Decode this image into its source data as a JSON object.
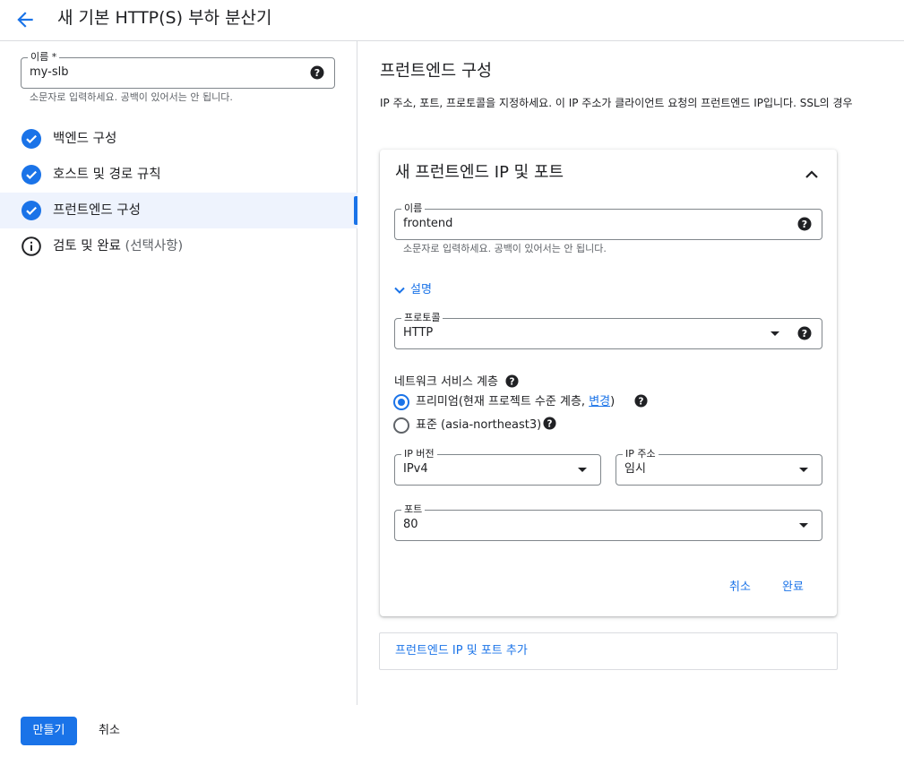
{
  "header": {
    "title": "새 기본 HTTP(S) 부하 분산기",
    "back_icon": "arrow-left-icon"
  },
  "name_field": {
    "label": "이름 *",
    "value": "my-slb",
    "hint": "소문자로 입력하세요. 공백이 있어서는 안 됩니다."
  },
  "steps": [
    {
      "label": "백엔드 구성",
      "icon": "check-circle-icon",
      "status": "complete"
    },
    {
      "label": "호스트 및 경로 규칙",
      "icon": "check-circle-icon",
      "status": "complete"
    },
    {
      "label": "프런트엔드 구성",
      "icon": "check-circle-icon",
      "status": "active"
    },
    {
      "label": "검토 및 완료",
      "optional": "(선택사항)",
      "icon": "info-icon",
      "status": "pending"
    }
  ],
  "main": {
    "title": "프런트엔드 구성",
    "description": "IP 주소, 포트, 프로토콜을 지정하세요. 이 IP 주소가 클라이언트 요청의 프런트엔드 IP입니다. SSL의 경우"
  },
  "card": {
    "title": "새 프런트엔드 IP 및 포트",
    "name": {
      "label": "이름",
      "value": "frontend",
      "hint": "소문자로 입력하세요. 공백이 있어서는 안 됩니다."
    },
    "description_toggle": "설명",
    "protocol": {
      "label": "프로토콜",
      "value": "HTTP"
    },
    "network_tier": {
      "label": "네트워크 서비스 계층",
      "premium_label": "프리미엄(현재 프로젝트 수준 계층, ",
      "premium_link": "변경",
      "premium_suffix": ")",
      "standard_label": "표준 (asia-northeast3)",
      "selected": "premium"
    },
    "ip_version": {
      "label": "IP 버전",
      "value": "IPv4"
    },
    "ip_address": {
      "label": "IP 주소",
      "value": "임시"
    },
    "port": {
      "label": "포트",
      "value": "80"
    },
    "cancel": "취소",
    "done": "완료"
  },
  "add_button": "프런트엔드 IP 및 포트 추가",
  "footer": {
    "create": "만들기",
    "cancel": "취소"
  },
  "colors": {
    "accent": "#1a73e8",
    "active_bg": "#eef3fd",
    "border": "#dadce0"
  }
}
